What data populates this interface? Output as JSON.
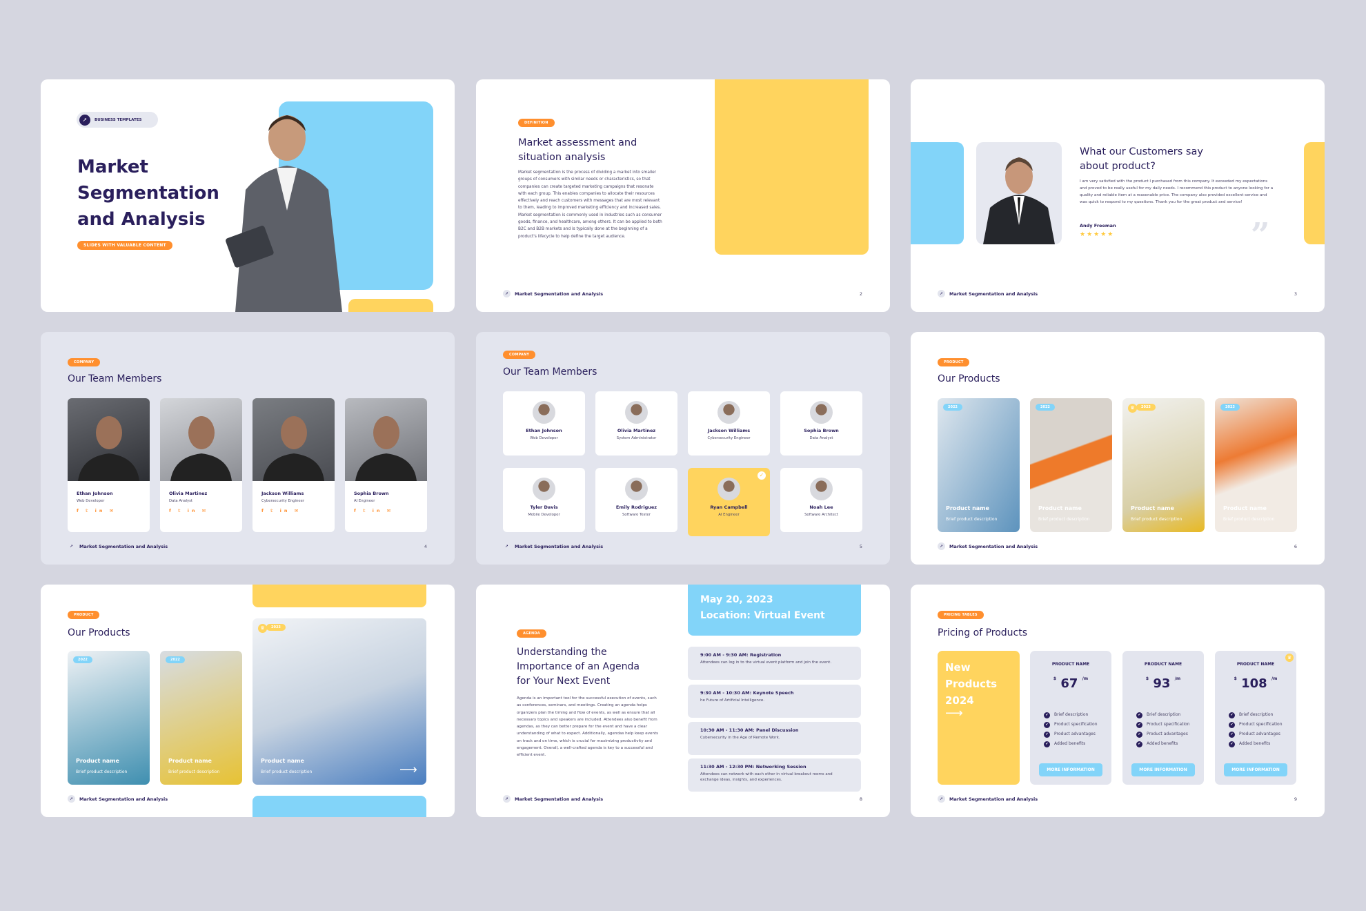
{
  "footer": "Market Segmentation and Analysis",
  "colors": {
    "navy": "#2a1f5c",
    "orange": "#ff8f2e",
    "blue": "#82d4f9",
    "yellow": "#ffd45e"
  },
  "s1": {
    "tag": "BUSINESS TEMPLATES",
    "title": "Market Segmentation and Analysis",
    "pill": "SLIDES WITH VALUABLE CONTENT"
  },
  "s2": {
    "tag": "DEFINITION",
    "title": "Market assessment and situation analysis",
    "body": "Market segmentation is the process of dividing a market into smaller groups of consumers with similar needs or characteristics, so that companies can create targeted marketing campaigns that resonate with each group. This enables companies to allocate their resources effectively and reach customers with messages that are most relevant to them, leading to improved marketing efficiency and increased sales. Market segmentation is commonly used in industries such as consumer goods, finance, and healthcare, among others. It can be applied to both B2C and B2B markets and is typically done at the beginning of a product's lifecycle to help define the target audience.",
    "page": "2"
  },
  "s3": {
    "title": "What our Customers say about product?",
    "body": "I am very satisfied with the product I purchased from this company. It exceeded my expectations and proved to be really useful for my daily needs. I recommend this product to anyone looking for a quality and reliable item at a reasonable price. The company also provided excellent service and was quick to respond to my questions. Thank you for the great product and service!",
    "name": "Andy Freeman",
    "rating": 5,
    "page": "3"
  },
  "s4": {
    "tag": "COMPANY",
    "title": "Our Team Members",
    "page": "4",
    "socials": "f 𝕥 in ✉",
    "members": [
      {
        "name": "Ethan Johnson",
        "role": "Web Developer"
      },
      {
        "name": "Olivia Martinez",
        "role": "Data Analyst"
      },
      {
        "name": "Jackson Williams",
        "role": "Cybersecurity Engineer"
      },
      {
        "name": "Sophia Brown",
        "role": "AI Engineer"
      }
    ]
  },
  "s5": {
    "tag": "COMPANY",
    "title": "Our Team Members",
    "page": "5",
    "members": [
      {
        "name": "Ethan Johnson",
        "role": "Web Developer"
      },
      {
        "name": "Olivia Martinez",
        "role": "System Administrator"
      },
      {
        "name": "Jackson Williams",
        "role": "Cybersecurity Engineer"
      },
      {
        "name": "Sophia Brown",
        "role": "Data Analyst"
      },
      {
        "name": "Tyler Davis",
        "role": "Mobile Developer"
      },
      {
        "name": "Emily Rodriguez",
        "role": "Software Tester"
      },
      {
        "name": "Ryan Campbell",
        "role": "AI Engineer",
        "selected": true
      },
      {
        "name": "Noah Lee",
        "role": "Software Architect"
      }
    ]
  },
  "s6": {
    "tag": "PRODUCT",
    "title": "Our Products",
    "page": "6",
    "products": [
      {
        "year": "2022",
        "name": "Product name",
        "desc": "Brief product description"
      },
      {
        "year": "2022",
        "name": "Product name",
        "desc": "Brief product description"
      },
      {
        "year": "2023",
        "name": "Product name",
        "desc": "Brief product description",
        "featured": true
      },
      {
        "year": "2023",
        "name": "Product name",
        "desc": "Brief product description"
      }
    ]
  },
  "s7": {
    "tag": "PRODUCT",
    "title": "Our Products",
    "products": [
      {
        "year": "2022",
        "name": "Product name",
        "desc": "Brief product description"
      },
      {
        "year": "2022",
        "name": "Product name",
        "desc": "Brief product description"
      },
      {
        "year": "2023",
        "name": "Product name",
        "desc": "Brief product description",
        "featured": true
      }
    ]
  },
  "s8": {
    "date": "May 20, 2023",
    "location": "Location: Virtual Event",
    "tag": "AGENDA",
    "title": "Understanding the Importance of an Agenda for Your Next Event",
    "body": "Agenda is an important tool for the successful execution of events, such as conferences, seminars, and meetings. Creating an agenda helps organizers plan the timing and flow of events, as well as ensure that all necessary topics and speakers are included. Attendees also benefit from agendas, as they can better prepare for the event and have a clear understanding of what to expect. Additionally, agendas help keep events on track and on time, which is crucial for maximizing productivity and engagement. Overall, a well-crafted agenda is key to a successful and efficient event.",
    "page": "8",
    "items": [
      {
        "time": "9:00 AM - 9:30 AM: Registration",
        "desc": "Attendees can log in to the virtual event platform and join the event."
      },
      {
        "time": "9:30 AM - 10:30 AM: Keynote Speech",
        "desc": "he Future of Artificial Intelligence."
      },
      {
        "time": "10:30 AM - 11:30 AM: Panel Discussion",
        "desc": "Cybersecurity in the Age of Remote Work."
      },
      {
        "time": "11:30 AM - 12:30 PM: Networking Session",
        "desc": "Attendees can network with each other in virtual breakout rooms and exchange ideas, insights, and experiences."
      }
    ]
  },
  "s9": {
    "tag": "PRICING TABLES",
    "title": "Pricing of Products",
    "promo": "New Products 2024",
    "page": "9",
    "plans": [
      {
        "name": "PRODUCT NAME",
        "currency": "$",
        "price": "67",
        "unit": "/m"
      },
      {
        "name": "PRODUCT NAME",
        "currency": "$",
        "price": "93",
        "unit": "/m"
      },
      {
        "name": "PRODUCT NAME",
        "currency": "$",
        "price": "108",
        "unit": "/m",
        "featured": true
      }
    ],
    "features": [
      "Brief description",
      "Product specification",
      "Product advantages",
      "Added benefits"
    ],
    "button": "MORE INFORMATION"
  }
}
